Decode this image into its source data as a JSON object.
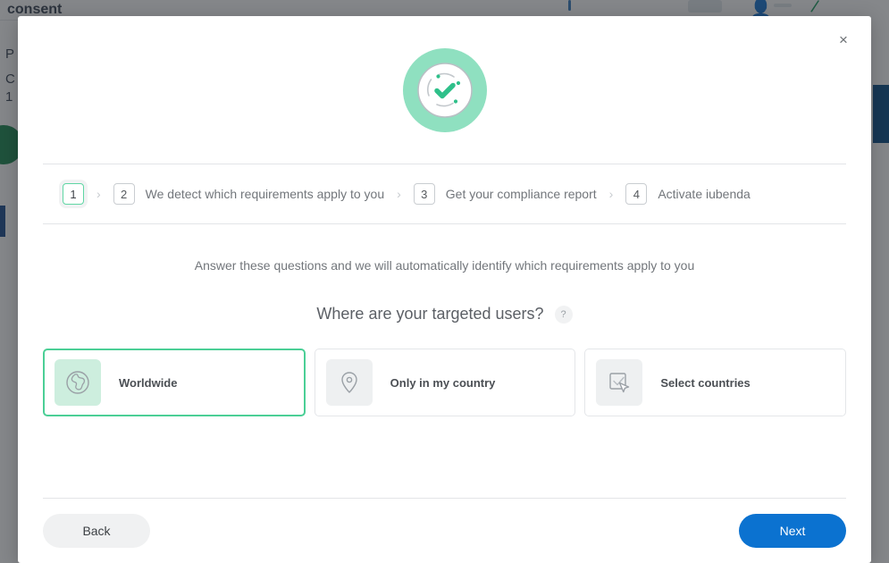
{
  "background": {
    "heading": "consent",
    "lines": [
      "P",
      "C",
      "1"
    ],
    "icons": [
      "person-icon",
      "slash-icon",
      "dash-icon",
      "dot-icon"
    ]
  },
  "modal": {
    "close_label": "×",
    "close_icon": "close-icon",
    "hero_icon": "check-circle-progress-icon",
    "steps": [
      {
        "number": "1",
        "label": "",
        "active": true
      },
      {
        "number": "2",
        "label": "We detect which requirements apply to you",
        "active": false
      },
      {
        "number": "3",
        "label": "Get your compliance report",
        "active": false
      },
      {
        "number": "4",
        "label": "Activate iubenda",
        "active": false
      }
    ],
    "step_separator": "›",
    "intro_text": "Answer these questions and we will automatically identify which requirements apply to you",
    "question": "Where are your targeted users?",
    "help_badge": "?",
    "options": [
      {
        "label": "Worldwide",
        "icon": "globe-icon",
        "selected": true
      },
      {
        "label": "Only in my country",
        "icon": "map-pin-icon",
        "selected": false
      },
      {
        "label": "Select countries",
        "icon": "checkbox-cursor-icon",
        "selected": false
      }
    ],
    "footer": {
      "back_label": "Back",
      "next_label": "Next"
    }
  },
  "colors": {
    "accent_green": "#4bcf96",
    "hero_green": "#8fe0c0",
    "tile_green": "#cdeede",
    "primary_blue": "#0b72d0",
    "text_gray": "#72767b"
  }
}
